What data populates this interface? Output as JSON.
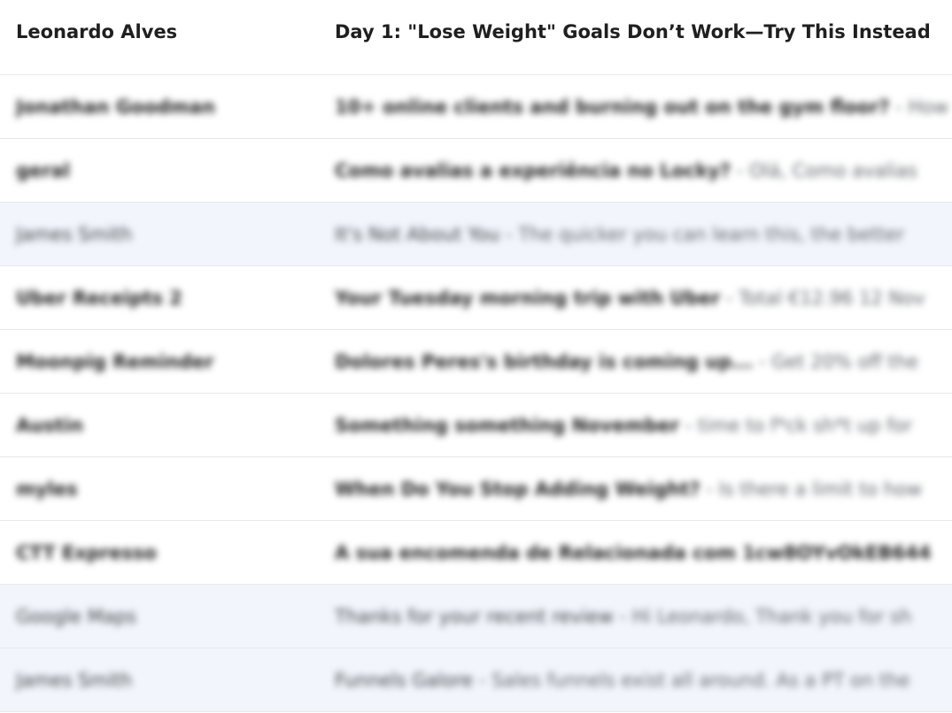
{
  "emails": [
    {
      "sender": "Leonardo Alves",
      "subject": "Day 1: \"Lose Weight\" Goals Don’t Work—Try This Instead",
      "snippet": ""
    },
    {
      "sender": "Jonathan Goodman",
      "subject": "10+ online clients and burning out on the gym floor?",
      "snippet": "How"
    },
    {
      "sender": "geral",
      "subject": "Como avalias a experiência no Locky?",
      "snippet": "Olá, Como avalias"
    },
    {
      "sender": "James Smith",
      "subject": "It's Not About You",
      "snippet": "The quicker you can learn this, the better"
    },
    {
      "sender": "Uber Receipts 2",
      "subject": "Your Tuesday morning trip with Uber",
      "snippet": "Total €12.96 12 Nov"
    },
    {
      "sender": "Moonpig Reminder",
      "subject": "Dolores Peres's birthday is coming up...",
      "snippet": "Get 20% off the"
    },
    {
      "sender": "Austin",
      "subject": "Something something November",
      "snippet": "time to f*ck sh*t up for"
    },
    {
      "sender": "myles",
      "subject": "When Do You Stop Adding Weight?",
      "snippet": "Is there a limit to how"
    },
    {
      "sender": "CTT Expresso",
      "subject": "A sua encomenda de Relacionada com 1cw8OYvOkEB644",
      "snippet": ""
    },
    {
      "sender": "Google Maps",
      "subject": "Thanks for your recent review",
      "snippet": "Hi Leonardo, Thank you for sh"
    },
    {
      "sender": "James Smith",
      "subject": "Funnels Galore",
      "snippet": "Sales funnels exist all around. As a PT on the"
    }
  ],
  "separator": " - "
}
